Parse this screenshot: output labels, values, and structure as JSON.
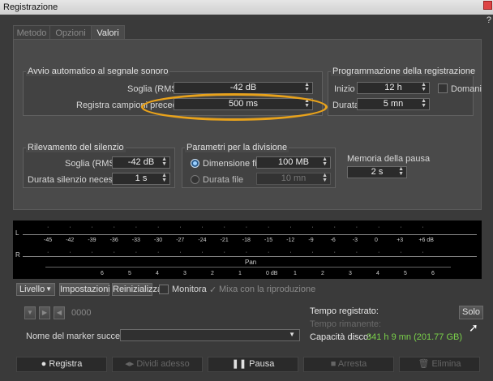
{
  "window": {
    "title": "Registrazione",
    "help": "?"
  },
  "tabs": [
    {
      "label": "Metodo"
    },
    {
      "label": "Opzioni"
    },
    {
      "label": "Valori"
    }
  ],
  "auto_start": {
    "title": "Avvio automatico al segnale sonoro",
    "threshold_label": "Soglia (RMS)",
    "threshold_value": "-42 dB",
    "pre_record_label": "Registra campioni precedenti",
    "pre_record_value": "500 ms"
  },
  "schedule": {
    "title": "Programmazione della registrazione",
    "start_label": "Inizio",
    "start_value": "12 h",
    "tomorrow_label": "Domani",
    "duration_label": "Durata",
    "duration_value": "5 mn"
  },
  "silence": {
    "title": "Rilevamento del silenzio",
    "threshold_label": "Soglia (RMS)",
    "threshold_value": "-42 dB",
    "duration_label": "Durata silenzio necessaria",
    "duration_value": "1 s"
  },
  "split": {
    "title": "Parametri per la divisione",
    "size_label": "Dimensione file",
    "size_value": "100 MB",
    "duration_label": "Durata file",
    "duration_value": "10 mn"
  },
  "pause_memory": {
    "label": "Memoria della pausa",
    "value": "2 s"
  },
  "meter": {
    "left_channel": "L",
    "right_channel": "R",
    "db_ticks": [
      "-45",
      "-42",
      "-39",
      "-36",
      "-33",
      "-30",
      "-27",
      "-24",
      "-21",
      "-18",
      "-15",
      "-12",
      "-9",
      "-6",
      "-3",
      "0",
      "+3",
      "+6 dB"
    ],
    "pan_label": "Pan",
    "pan_ticks": [
      "6",
      "5",
      "4",
      "3",
      "2",
      "1",
      "0 dB",
      "1",
      "2",
      "3",
      "4",
      "5",
      "6"
    ]
  },
  "toolbar": {
    "level": "Livello",
    "settings": "Impostazioni",
    "reset": "Reinizializza",
    "monitor": "Monitora",
    "mix": "Mixa con la riproduzione"
  },
  "transport": {
    "counter": "0000"
  },
  "marker": {
    "label": "Nome del marker successivo"
  },
  "status": {
    "recorded_label": "Tempo registrato:",
    "remaining_label": "Tempo rimanente:",
    "disk_label": "Capacità disco:",
    "disk_value": "341 h 9 mn (201.77 GB)",
    "solo": "Solo"
  },
  "buttons": {
    "record": "Registra",
    "split_now": "Dividi adesso",
    "pause": "Pausa",
    "stop": "Arresta",
    "delete": "Elimina"
  },
  "colors": {
    "highlight": "#e8a21b",
    "disk_green": "#7bd34a"
  }
}
